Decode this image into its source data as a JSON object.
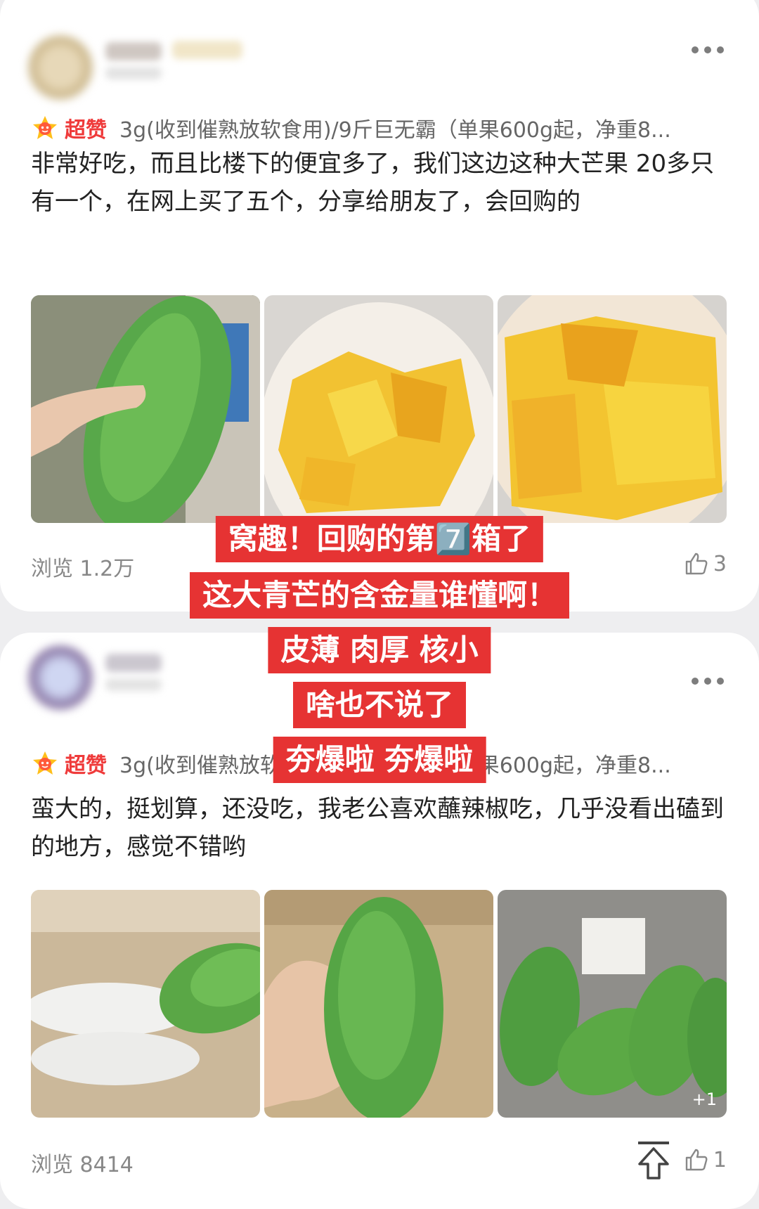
{
  "reviews": [
    {
      "badge": "超赞",
      "variant": "3g(收到催熟放软食用)/9斤巨无霸（单果600g起，净重8...",
      "text": "非常好吃，而且比楼下的便宜多了，我们这边这种大芒果 20多只有一个，在网上买了五个，分享给朋友了，会回购的",
      "views": "浏览 1.2万",
      "likes": "3"
    },
    {
      "badge": "超赞",
      "variant": "3g(收到催熟放软食用)/9斤巨无霸（单果600g起，净重8...",
      "text": "蛮大的，挺划算，还没吃，我老公喜欢蘸辣椒吃，几乎没看出磕到的地方，感觉不错哟",
      "views": "浏览 8414",
      "likes": "1",
      "more_photos": "+1"
    }
  ],
  "overlay": {
    "lines": [
      "窝趣！回购的第7️⃣箱了",
      "这大青芒的含金量谁懂啊！",
      "皮薄 肉厚 核小",
      "啥也不说了",
      "夯爆啦 夯爆啦"
    ]
  },
  "colors": {
    "accent_red": "#e63333",
    "badge_red": "#ef3a3a",
    "card_bg": "#ffffff",
    "page_bg": "#eeeef0"
  }
}
